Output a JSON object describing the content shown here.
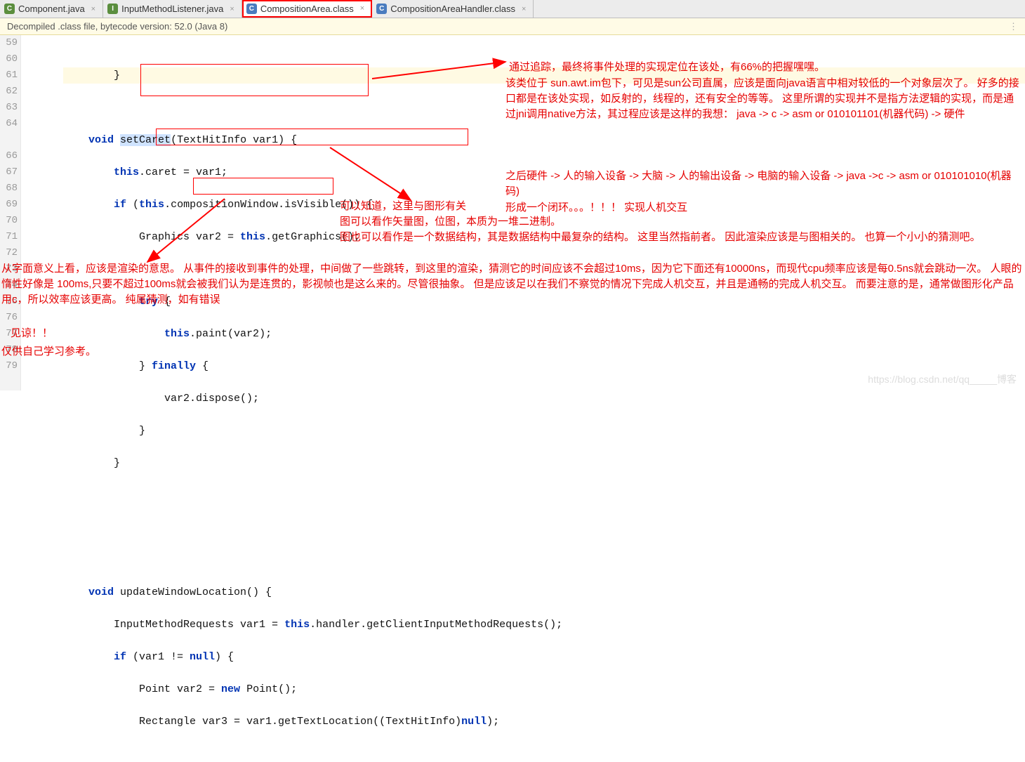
{
  "tabs": [
    {
      "icon": "C",
      "iconCls": "ic-c",
      "label": "Component.java"
    },
    {
      "icon": "I",
      "iconCls": "ic-i",
      "label": "InputMethodListener.java"
    },
    {
      "icon": "C",
      "iconCls": "ic-cl",
      "label": "CompositionArea.class"
    },
    {
      "icon": "C",
      "iconCls": "ic-cl",
      "label": "CompositionAreaHandler.class"
    }
  ],
  "banner": "Decompiled .class file, bytecode version: 52.0 (Java 8)",
  "lines": {
    "l59": "59",
    "l60": "60",
    "l61": "61",
    "l62": "62",
    "l63": "63",
    "l64": "64",
    "l66": "66",
    "l67": "67",
    "l68": "68",
    "l69": "69",
    "l70": "70",
    "l71": "71",
    "l72": "72",
    "l73": "73",
    "l74": "74",
    "l75": "75",
    "l76": "76",
    "l77": "77",
    "l78": "78",
    "l79": "79"
  },
  "code": {
    "r59": "        }",
    "r61a": "    ",
    "r61_void": "void",
    "r61b": " ",
    "r61_set": "setCaret",
    "r61c": "(TextHitInfo var1) {",
    "r62a": "        ",
    "r62_this": "this",
    "r62b": ".caret = var1;",
    "r63a": "        ",
    "r63_if": "if",
    "r63b": " (",
    "r63_this": "this",
    "r63c": ".compositionWindow.isVisible()) {",
    "r64a": "            Graphics var2 = ",
    "r64_this": "this",
    "r64b": ".getGraphics();",
    "r66a": "            ",
    "r66_try": "try",
    "r66b": " {",
    "r67a": "                ",
    "r67_this": "this",
    "r67b": ".paint(var2);",
    "r68a": "            } ",
    "r68_fin": "finally",
    "r68b": " {",
    "r69": "                var2.dispose();",
    "r70": "            }",
    "r71": "        }",
    "r75a": "    void",
    "r75b": " updateWindowLocation() {",
    "r76a": "        InputMethodRequests var1 = ",
    "r76_this": "this",
    "r76b": ".handler.getClientInputMethodRequests();",
    "r77a": "        if",
    "r77b": " (var1 != ",
    "r77_null": "null",
    "r77c": ") {",
    "r78a": "            Point var2 = ",
    "r78_new": "new",
    "r78b": " Point();",
    "r79a": "            Rectangle var3 = var1.getTextLocation((TextHitInfo)",
    "r79_null": "null",
    "r79b": ");"
  },
  "ann": {
    "a1": "通过追踪，最终将事件处理的实现定位在该处，有66%的把握嘿嘿。",
    "a2": "     该类位于   sun.awt.im包下，可见是sun公司直属，应该是面向java语言中相对较低的一个对象层次了。   好多的接口都是在该处实现，如反射的，线程的，还有安全的等等。  这里所谓的实现并不是指方法逻辑的实现，而是通过jni调用native方法，其过程应该是这样的我想：   java -> c -> asm or 010101101(机器代码)  -> 硬件",
    "a3": "     之后硬件 -> 人的输入设备 -> 大脑 -> 人的输出设备 -> 电脑的输入设备 -> java ->c -> asm or 010101010(机器码)",
    "a4": "     形成一个闭环。。。！！！    实现人机交互",
    "a5": "可以知道，这里与图形有关",
    "a6": "图可以看作矢量图，位图，本质为一堆二进制。",
    "a7": "图也可以看作是一个数据结构，其是数据结构中最复杂的结构。  这里当然指前者。   因此渲染应该是与图相关的。  也算一个小小的猜测吧。",
    "a8": "从字面意义上看，应该是渲染的意思。  从事件的接收到事件的处理，中间做了一些跳转，到这里的渲染，猜测它的时间应该不会超过10ms，因为它下面还有10000ns，而现代cpu频率应该是每0.5ns就会跳动一次。   人眼的惰性好像是 100ms,只要不超过100ms就会被我们认为是连贯的，影视帧也是这么来的。尽管很抽象。  但是应该足以在我们不察觉的情况下完成人机交互，并且是通畅的完成人机交互。   而要注意的是，通常做图形化产品用c，所以效率应该更高。    纯属猜测，如有错误",
    "a9": "    见谅！！",
    "a10": "仅供自己学习参考。"
  },
  "watermark": "https://blog.csdn.net/qq_____博客"
}
